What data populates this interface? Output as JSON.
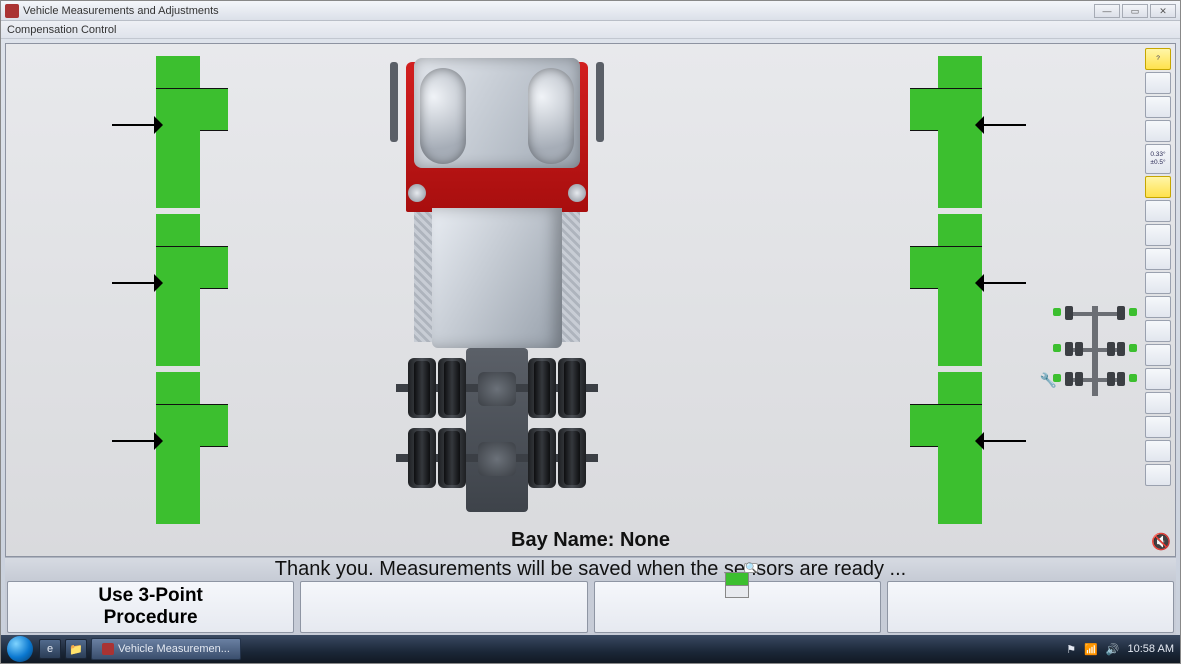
{
  "window": {
    "title": "Vehicle Measurements and Adjustments",
    "min": "—",
    "max": "▭",
    "close": "✕"
  },
  "menu": {
    "compensation": "Compensation Control"
  },
  "bay_label": "Bay Name: None",
  "status_message": "Thank you.  Measurements will be saved when the sensors are ready ...",
  "buttons": {
    "b1": "Use 3-Point\nProcedure",
    "b2": "",
    "b3": "",
    "b4": ""
  },
  "toolbar": {
    "t1": "?",
    "t2": "",
    "t3": "",
    "t4": "",
    "t5": "0.33°\n±0.5°",
    "t6": "",
    "t7": "",
    "t8": "",
    "t9": "",
    "t10": "",
    "t11": "",
    "t12": "",
    "t13": "",
    "t14": "",
    "t15": "",
    "t16": "",
    "t17": "",
    "t18": ""
  },
  "taskbar": {
    "task_label": "Vehicle Measuremen...",
    "clock": "10:58 AM"
  }
}
